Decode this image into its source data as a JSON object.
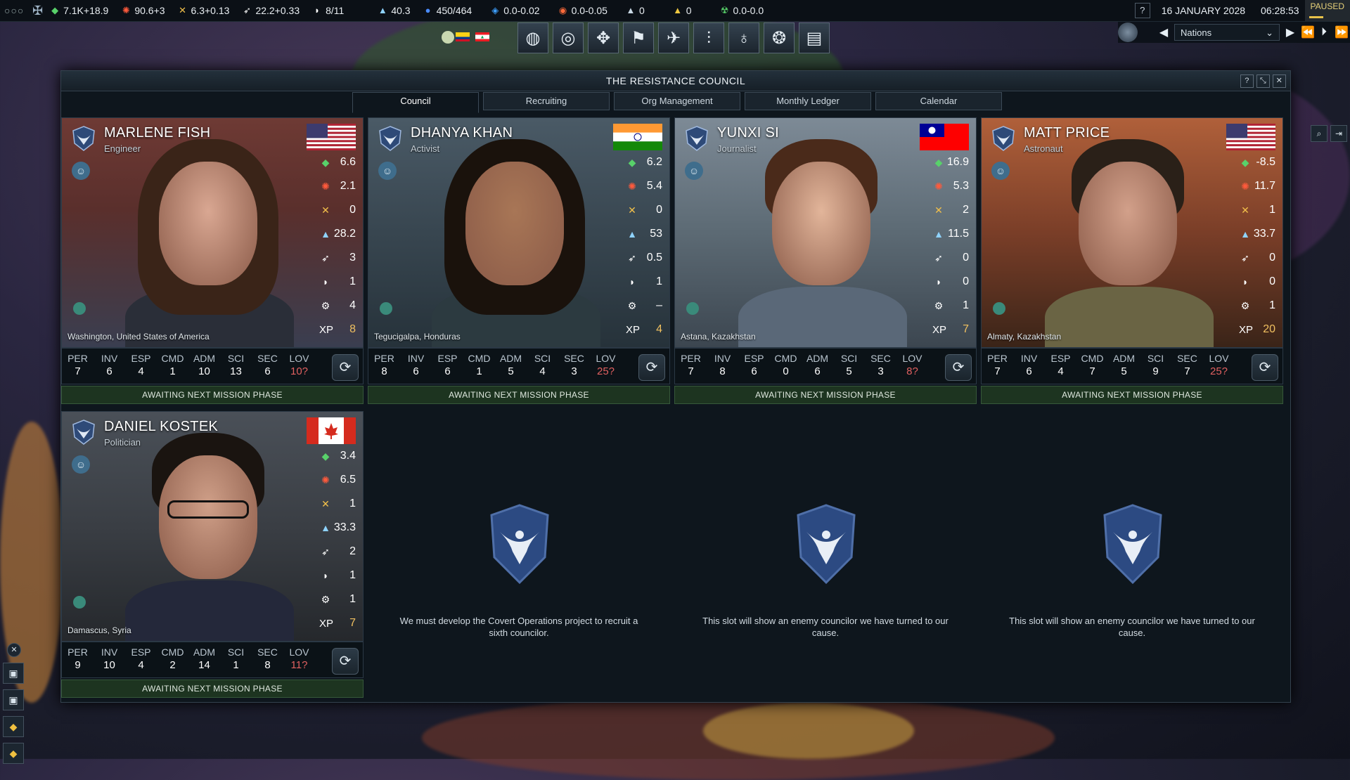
{
  "topbar": {
    "resources": [
      {
        "icon": "influence-icon",
        "glyph": "◆",
        "color": "#58d16a",
        "value": "7.1K+18.9"
      },
      {
        "icon": "ops-icon",
        "glyph": "✺",
        "color": "#ff5a3c",
        "value": "90.6+3"
      },
      {
        "icon": "boost-icon",
        "glyph": "✕",
        "color": "#f2c04a",
        "value": "6.3+0.13"
      },
      {
        "icon": "rocket-icon",
        "glyph": "➶",
        "color": "#ffffff",
        "value": "22.2+0.33"
      },
      {
        "icon": "mission-control-icon",
        "glyph": "◗",
        "color": "#ffffff",
        "value": "8/11"
      },
      {
        "icon": "research-icon",
        "glyph": "▲",
        "color": "#8fd3ff",
        "value": "40.3"
      },
      {
        "icon": "earth-icon",
        "glyph": "●",
        "color": "#4a8bff",
        "value": "450/464"
      },
      {
        "icon": "water-icon",
        "glyph": "◈",
        "color": "#3ea0ff",
        "value": "0.0-0.02"
      },
      {
        "icon": "volatiles-icon",
        "glyph": "◉",
        "color": "#ff6a3a",
        "value": "0.0-0.05"
      },
      {
        "icon": "metals-icon",
        "glyph": "▲",
        "color": "#c9d8e4",
        "value": "0"
      },
      {
        "icon": "nobles-icon",
        "glyph": "▲",
        "color": "#f0c840",
        "value": "0"
      },
      {
        "icon": "fissiles-icon",
        "glyph": "☢",
        "color": "#58d16a",
        "value": "0.0-0.0"
      }
    ],
    "help_label": "?",
    "date": "16 JANUARY 2028",
    "time": "06:28:53",
    "paused": "PAUSED"
  },
  "nav": {
    "icons": [
      "globe-icon",
      "target-icon",
      "org-icon",
      "flag-icon",
      "fleet-icon",
      "research-tree-icon",
      "idea-icon",
      "brain-icon",
      "news-icon"
    ],
    "glyphs": [
      "◍",
      "◎",
      "✥",
      "⚑",
      "✈",
      "⫶",
      "♁",
      "❂",
      "▤"
    ],
    "selector": "Nations"
  },
  "window": {
    "title": "THE RESISTANCE COUNCIL",
    "buttons": [
      "?",
      "⤡",
      "✕"
    ],
    "tabs": [
      "Council",
      "Recruiting",
      "Org Management",
      "Monthly Ledger",
      "Calendar"
    ]
  },
  "attr_names": [
    "PER",
    "INV",
    "ESP",
    "CMD",
    "ADM",
    "SCI",
    "SEC",
    "LOV"
  ],
  "status_text": "AWAITING NEXT MISSION PHASE",
  "councilors": [
    {
      "name": "MARLENE FISH",
      "role": "Engineer",
      "location": "Washington, United States of America",
      "flag": "usa",
      "stats": [
        "6.6",
        "2.1",
        "0",
        "28.2",
        "3",
        "1",
        "4"
      ],
      "xp": "8",
      "attrs": [
        "7",
        "6",
        "4",
        "1",
        "10",
        "13",
        "6",
        "10?"
      ]
    },
    {
      "name": "DHANYA KHAN",
      "role": "Activist",
      "location": "Tegucigalpa, Honduras",
      "flag": "india",
      "stats": [
        "6.2",
        "5.4",
        "0",
        "53",
        "0.5",
        "1",
        "–"
      ],
      "xp": "4",
      "attrs": [
        "8",
        "6",
        "6",
        "1",
        "5",
        "4",
        "3",
        "25?"
      ]
    },
    {
      "name": "YUNXI SI",
      "role": "Journalist",
      "location": "Astana, Kazakhstan",
      "flag": "taiwan",
      "stats": [
        "16.9",
        "5.3",
        "2",
        "11.5",
        "0",
        "0",
        "1"
      ],
      "xp": "7",
      "attrs": [
        "7",
        "8",
        "6",
        "0",
        "6",
        "5",
        "3",
        "8?"
      ]
    },
    {
      "name": "MATT PRICE",
      "role": "Astronaut",
      "location": "Almaty, Kazakhstan",
      "flag": "usa",
      "stats": [
        "-8.5",
        "11.7",
        "1",
        "33.7",
        "0",
        "0",
        "1"
      ],
      "xp": "20",
      "attrs": [
        "7",
        "6",
        "4",
        "7",
        "5",
        "9",
        "7",
        "25?"
      ]
    },
    {
      "name": "DANIEL KOSTEK",
      "role": "Politician",
      "location": "Damascus, Syria",
      "flag": "canada",
      "stats": [
        "3.4",
        "6.5",
        "1",
        "33.3",
        "2",
        "1",
        "1"
      ],
      "xp": "7",
      "attrs": [
        "9",
        "10",
        "4",
        "2",
        "14",
        "1",
        "8",
        "11?"
      ]
    }
  ],
  "stat_icons": [
    {
      "name": "influence-icon",
      "glyph": "◆",
      "color": "#58d16a"
    },
    {
      "name": "ops-icon",
      "glyph": "✺",
      "color": "#ff5a3c"
    },
    {
      "name": "boost-icon",
      "glyph": "✕",
      "color": "#f2c04a"
    },
    {
      "name": "research-icon",
      "glyph": "▲",
      "color": "#8fd3ff"
    },
    {
      "name": "rocket-icon",
      "glyph": "➶",
      "color": "#ffffff"
    },
    {
      "name": "mission-control-icon",
      "glyph": "◗",
      "color": "#ffffff"
    },
    {
      "name": "boost-gear-icon",
      "glyph": "⚙",
      "color": "#ffffff"
    }
  ],
  "xp_label": "XP",
  "empty_slots": [
    {
      "text": "We must develop the Covert Operations project to recruit a sixth councilor."
    },
    {
      "text": "This slot will show an enemy councilor we have turned to our cause."
    },
    {
      "text": "This slot will show an enemy councilor we have turned to our cause."
    }
  ]
}
